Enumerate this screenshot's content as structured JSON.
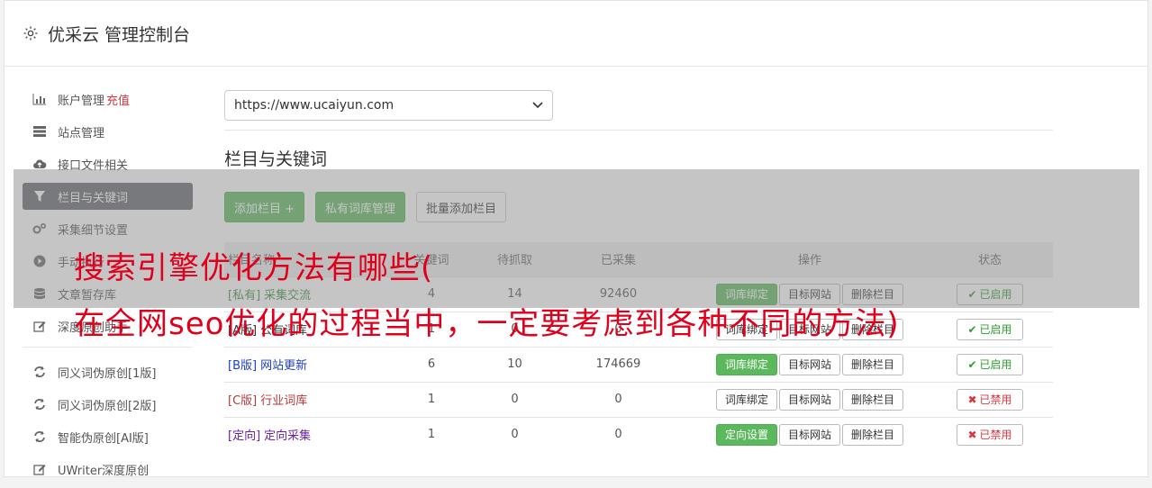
{
  "header": {
    "icon": "gear-icon",
    "title": "优采云 管理控制台"
  },
  "sidebar": {
    "group1": [
      {
        "icon": "bar-chart-icon",
        "label": "账户管理",
        "extra": "充值",
        "active": false
      },
      {
        "icon": "server-icon",
        "label": "站点管理",
        "extra": "",
        "active": false
      },
      {
        "icon": "cloud-upload-icon",
        "label": "接口文件相关",
        "extra": "",
        "active": false
      },
      {
        "icon": "filter-icon",
        "label": "栏目与关键词",
        "extra": "",
        "active": true
      },
      {
        "icon": "gears-icon",
        "label": "采集细节设置",
        "extra": "",
        "active": false
      },
      {
        "icon": "play-circle-icon",
        "label": "手动执行",
        "extra": "",
        "active": false
      },
      {
        "icon": "database-icon",
        "label": "文章暂存库",
        "extra": "",
        "active": false
      },
      {
        "icon": "edit-icon",
        "label": "深度原创助手",
        "extra": "",
        "active": false
      }
    ],
    "group2": [
      {
        "icon": "refresh-icon",
        "label": "同义词伪原创[1版]"
      },
      {
        "icon": "refresh-icon",
        "label": "同义词伪原创[2版]"
      },
      {
        "icon": "refresh-icon",
        "label": "智能伪原创[AI版]"
      },
      {
        "icon": "edit-icon",
        "label": "UWriter深度原创"
      }
    ]
  },
  "main": {
    "site_select": "https://www.ucaiyun.com",
    "section_title": "栏目与关键词",
    "buttons": {
      "add": "添加栏目 +",
      "private": "私有词库管理",
      "batch": "批量添加栏目"
    },
    "table": {
      "headers": [
        "栏目名称",
        "关键词",
        "待抓取",
        "已采集",
        "操作",
        "状态"
      ],
      "rows": [
        {
          "tag": "[私有]",
          "name": "采集交流",
          "color": "#3c8f3c",
          "keywords": "4",
          "pending": "14",
          "collected": "92460",
          "op1": "词库绑定",
          "op1_green": true,
          "op2": "目标网站",
          "op3": "删除栏目",
          "status": "已启用",
          "on": true
        },
        {
          "tag": "[A版]",
          "name": "公有词库",
          "color": "#333333",
          "keywords": "1",
          "pending": "0",
          "collected": "0",
          "op1": "词库绑定",
          "op1_green": false,
          "op2": "目标网站",
          "op3": "删除栏目",
          "status": "已启用",
          "on": true
        },
        {
          "tag": "[B版]",
          "name": "网站更新",
          "color": "#1a3fc4",
          "keywords": "6",
          "pending": "10",
          "collected": "174669",
          "op1": "词库绑定",
          "op1_green": true,
          "op2": "目标网站",
          "op3": "删除栏目",
          "status": "已启用",
          "on": true
        },
        {
          "tag": "[C版]",
          "name": "行业词库",
          "color": "#b23b3b",
          "keywords": "1",
          "pending": "0",
          "collected": "0",
          "op1": "词库绑定",
          "op1_green": false,
          "op2": "目标网站",
          "op3": "删除栏目",
          "status": "已禁用",
          "on": false
        },
        {
          "tag": "[定向]",
          "name": "定向采集",
          "color": "#6a1fa8",
          "keywords": "1",
          "pending": "0",
          "collected": "0",
          "op1": "定向设置",
          "op1_green": true,
          "op2": "目标网站",
          "op3": "删除栏目",
          "status": "已禁用",
          "on": false
        }
      ]
    }
  },
  "overlay": {
    "line1": "搜索引擎优化方法有哪些(",
    "line2": "在全网seo优化的过程当中，一定要考虑到各种不同的方法)"
  }
}
